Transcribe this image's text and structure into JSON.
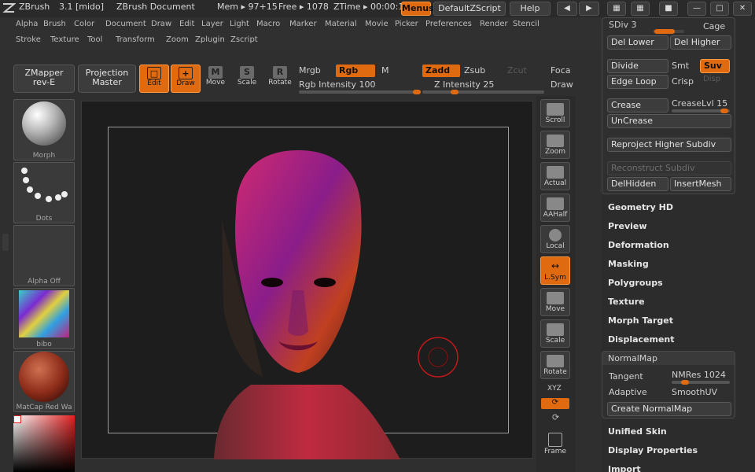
{
  "titlebar": {
    "app": "ZBrush",
    "version": "3.1 [mido]",
    "document": "ZBrush Document",
    "mem": "Mem ▸ 97+15",
    "free": "Free ▸ 1078",
    "ztime": "ZTime ▸ 00:00:1",
    "menus_button": "Menus",
    "script_button": "DefaultZScript",
    "help_button": "Help"
  },
  "menubar": {
    "row1": [
      "Alpha",
      "Brush",
      "Color",
      "Document",
      "Draw",
      "Edit",
      "Layer",
      "Light",
      "Macro",
      "Marker",
      "Material",
      "Movie",
      "Picker",
      "Preferences",
      "Render",
      "Stencil"
    ],
    "row2": [
      "Stroke",
      "Texture",
      "Tool",
      "Transform",
      "Zoom",
      "Zplugin",
      "Zscript"
    ]
  },
  "toolbar": {
    "zmapper_line1": "ZMapper",
    "zmapper_line2": "rev-E",
    "projection_line1": "Projection",
    "projection_line2": "Master",
    "edit": "Edit",
    "draw": "Draw",
    "move": "Move",
    "scale": "Scale",
    "rotate": "Rotate",
    "mrgb": "Mrgb",
    "rgb": "Rgb",
    "m": "M",
    "rgb_intensity_label": "Rgb Intensity",
    "rgb_intensity_value": "100",
    "rgb_intensity_fraction": 1.0,
    "zadd": "Zadd",
    "zsub": "Zsub",
    "zcut": "Zcut",
    "z_intensity_label": "Z Intensity",
    "z_intensity_value": "25",
    "z_intensity_fraction": 0.25,
    "focal": "Foca",
    "draw_size": "Draw"
  },
  "leftpalette": {
    "material_caption": "Morph",
    "stroke_caption": "Dots",
    "alpha_caption": "Alpha  Off",
    "texture_caption": "bibo",
    "matcap_caption": "MatCap  Red  Wa"
  },
  "rightshelf": {
    "scroll": "Scroll",
    "zoom": "Zoom",
    "actual": "Actual",
    "aahalf": "AAHalf",
    "local": "Local",
    "lsym": "L.Sym",
    "move": "Move",
    "scale": "Scale",
    "rotate": "Rotate",
    "xyz": "XYZ",
    "frame": "Frame"
  },
  "geometry": {
    "sdiv_label": "SDiv 3",
    "cage": "Cage",
    "del_lower": "Del Lower",
    "del_higher": "Del Higher",
    "divide": "Divide",
    "smt": "Smt",
    "suv": "Suv",
    "edge_loop": "Edge Loop",
    "crisp": "Crisp",
    "disp": "Disp",
    "crease": "Crease",
    "crease_lvl_label": "CreaseLvl",
    "crease_lvl_value": "15",
    "uncrease": "UnCrease",
    "reproject": "Reproject Higher Subdiv",
    "reconstruct": "Reconstruct Subdiv",
    "delhidden": "DelHidden",
    "insertmesh": "InsertMesh"
  },
  "sections": {
    "geometry_hd": "Geometry HD",
    "preview": "Preview",
    "deformation": "Deformation",
    "masking": "Masking",
    "polygroups": "Polygroups",
    "texture": "Texture",
    "morph_target": "Morph Target",
    "displacement": "Displacement",
    "unified_skin": "Unified Skin",
    "display_properties": "Display Properties",
    "import": "Import"
  },
  "normalmap": {
    "title": "NormalMap",
    "tangent": "Tangent",
    "nmres_label": "NMRes",
    "nmres_value": "1024",
    "adaptive": "Adaptive",
    "smoothuv": "SmoothUV",
    "create": "Create NormalMap"
  },
  "colors": {
    "accent": "#e06a10",
    "panel": "#2f2f2f",
    "canvas": "#1d1d1d"
  }
}
